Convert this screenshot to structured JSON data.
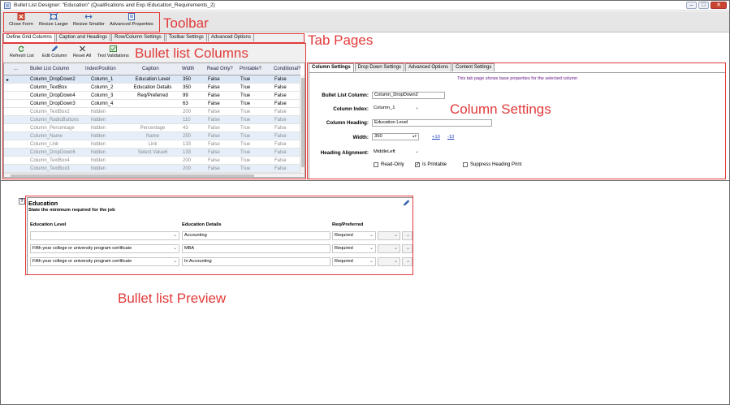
{
  "window": {
    "title": "Bullet List Designer: \"Education\" (Qualifications and Exp.\\Education_Requirements_2)",
    "buttons": [
      "–",
      "□",
      "✕"
    ]
  },
  "toolbar": {
    "buttons": [
      {
        "label": "Close Form",
        "icon": "close-form-icon"
      },
      {
        "label": "Resize Larger",
        "icon": "resize-larger-icon"
      },
      {
        "label": "Resize Smaller",
        "icon": "resize-smaller-icon"
      },
      {
        "label": "Advanced Properties",
        "icon": "advanced-properties-icon"
      }
    ]
  },
  "annotations": {
    "toolbar": "Toolbar",
    "tab_pages": "Tab Pages",
    "bullet_list_columns": "Bullet list Columns",
    "column_settings": "Column Settings",
    "bullet_list_preview": "Bullet list Preview",
    "color": "#e23a3a"
  },
  "main_tabs": [
    "Define Grid Columns",
    "Caption and Headings",
    "Row/Column Settings",
    "Toolbar Settings",
    "Advanced Options"
  ],
  "grid_toolbar": [
    {
      "label": "Refresh List",
      "icon": "refresh-icon"
    },
    {
      "label": "Edit Column",
      "icon": "pencil-icon"
    },
    {
      "label": "Reset All",
      "icon": "x-icon"
    },
    {
      "label": "Test Validations",
      "icon": "test-validations-icon"
    }
  ],
  "grid": {
    "columns": [
      "...",
      "Bullet List Column",
      "Index/Position",
      "Caption",
      "Width",
      "Read Only?",
      "Printable?",
      "Conditional?"
    ],
    "rows": [
      {
        "name": "Column_DropDown2",
        "index": "Column_1",
        "caption": "Education Level",
        "width": "350",
        "readonly": "False",
        "printable": "True",
        "conditional": "False",
        "visible": true
      },
      {
        "name": "Column_TextBox",
        "index": "Column_2",
        "caption": "Education Details",
        "width": "350",
        "readonly": "False",
        "printable": "True",
        "conditional": "False",
        "visible": true
      },
      {
        "name": "Column_DropDown4",
        "index": "Column_3",
        "caption": "Req/Preferred",
        "width": "99",
        "readonly": "False",
        "printable": "True",
        "conditional": "False",
        "visible": true
      },
      {
        "name": "Column_DropDown3",
        "index": "Column_4",
        "caption": "",
        "width": "63",
        "readonly": "False",
        "printable": "True",
        "conditional": "False",
        "visible": true
      },
      {
        "name": "Column_TextBox2",
        "index": "hidden",
        "caption": "",
        "width": "200",
        "readonly": "False",
        "printable": "True",
        "conditional": "False",
        "visible": false
      },
      {
        "name": "Column_RadioButtons",
        "index": "hidden",
        "caption": "",
        "width": "110",
        "readonly": "False",
        "printable": "True",
        "conditional": "False",
        "visible": false
      },
      {
        "name": "Column_Percentage",
        "index": "hidden",
        "caption": "Percentage",
        "width": "43",
        "readonly": "False",
        "printable": "True",
        "conditional": "False",
        "visible": false
      },
      {
        "name": "Column_Name",
        "index": "hidden",
        "caption": "Name",
        "width": "250",
        "readonly": "False",
        "printable": "True",
        "conditional": "False",
        "visible": false
      },
      {
        "name": "Column_Link",
        "index": "hidden",
        "caption": "Link",
        "width": "133",
        "readonly": "False",
        "printable": "True",
        "conditional": "False",
        "visible": false
      },
      {
        "name": "Column_DropDown6",
        "index": "hidden",
        "caption": "Select Value6",
        "width": "133",
        "readonly": "False",
        "printable": "True",
        "conditional": "False",
        "visible": false
      },
      {
        "name": "Column_TextBox4",
        "index": "hidden",
        "caption": "",
        "width": "200",
        "readonly": "False",
        "printable": "True",
        "conditional": "False",
        "visible": false
      },
      {
        "name": "Column_TextBox3",
        "index": "hidden",
        "caption": "",
        "width": "200",
        "readonly": "False",
        "printable": "True",
        "conditional": "False",
        "visible": false
      }
    ]
  },
  "settings_tabs": [
    "Column Settings",
    "Drop Down Settings",
    "Advanced Options",
    "Content Settings"
  ],
  "column_settings": {
    "info": "This tab page shows base properties for the selected column",
    "bullet_list_column_label": "Bullet List Column:",
    "bullet_list_column_value": "Column_DropDown2",
    "column_index_label": "Column Index:",
    "column_index_value": "Column_1",
    "column_heading_label": "Column Heading:",
    "column_heading_value": "Education Level",
    "width_label": "Width:",
    "width_value": "350",
    "plus10": "+10",
    "minus10": "-10",
    "heading_alignment_label": "Heading Alignment:",
    "heading_alignment_value": "MiddleLeft",
    "readonly_label": "Read-Only",
    "readonly_checked": false,
    "printable_label": "Is Printable",
    "printable_checked": true,
    "suppress_label": "Suppress Heading Print",
    "suppress_checked": false
  },
  "preview": {
    "help": "?",
    "title": "Education",
    "subtitle": "State the minimum required for the job",
    "headers": [
      "Education Level",
      "Education Details",
      "Req/Preferred"
    ],
    "rows": [
      {
        "level": "",
        "details": "Accounting",
        "req": "Required"
      },
      {
        "level": "Fifth year college or university program certificate",
        "details": "MBA",
        "req": "Required"
      },
      {
        "level": "Fifth year college or university program certificate",
        "details": "In Accounting",
        "req": "Required"
      }
    ]
  }
}
